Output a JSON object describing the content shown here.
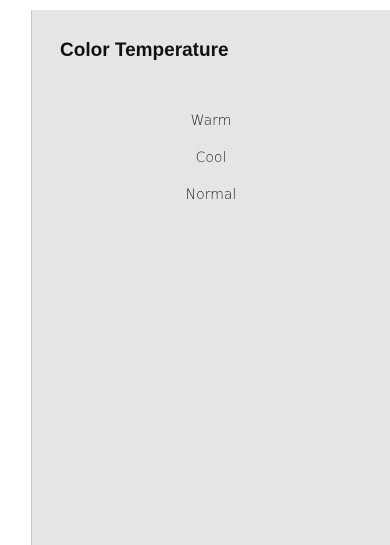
{
  "panel": {
    "title": "Color Temperature",
    "options": [
      {
        "label": "Warm"
      },
      {
        "label": "Cool"
      },
      {
        "label": "Normal"
      }
    ]
  }
}
